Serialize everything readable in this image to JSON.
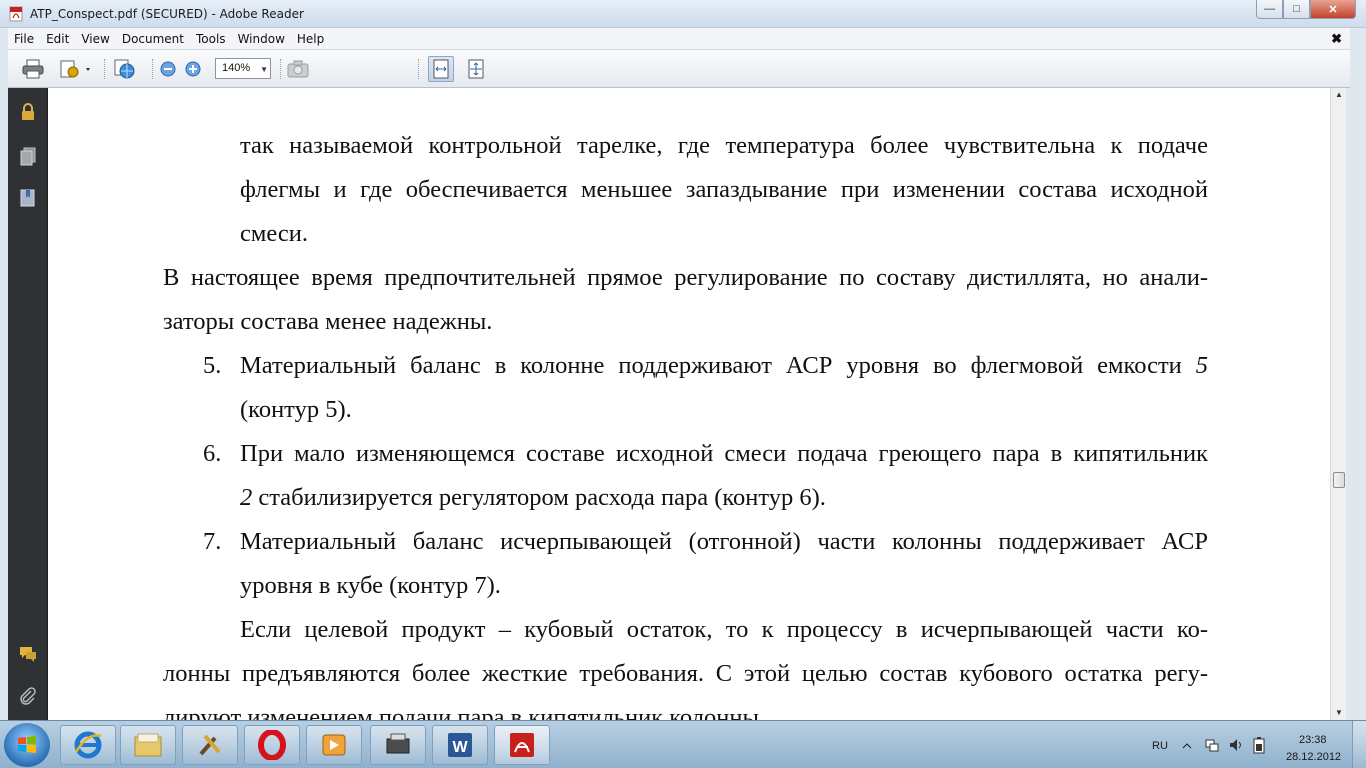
{
  "window": {
    "title": "ATP_Conspect.pdf (SECURED) - Adobe Reader",
    "min_glyph": "—",
    "max_glyph": "□",
    "close_glyph": "✕"
  },
  "menu": [
    "File",
    "Edit",
    "View",
    "Document",
    "Tools",
    "Window",
    "Help"
  ],
  "menu_close": "✖",
  "toolbar": {
    "zoom_value": "140%",
    "zoom_arrow": "▼"
  },
  "document": {
    "line1": "так называемой контрольной тарелке, где температура более чувствительна к подаче",
    "line2": "флегмы и где обеспечивается меньшее запаздывание при изменении состава исходной",
    "line3": "смеси.",
    "line4": "В настоящее время предпочтительней прямое регулирование по составу дистиллята, но анали-",
    "line5": "заторы состава менее надежны.",
    "item5_num": "5.",
    "item5_l1_text": "Материальный баланс в колонне поддерживают АСР уровня во флегмовой емкости",
    "item5_l1_ital": "5",
    "item5_l2": "(контур 5).",
    "item6_num": "6.",
    "item6_l1": "При мало изменяющемся составе исходной смеси подача греющего пара в кипятильник",
    "item6_l2_ital": "2",
    "item6_l2_text": " стабилизируется регулятором расхода пара (контур 6).",
    "item7_num": "7.",
    "item7_l1": "Материальный баланс исчерпывающей (отгонной) части колонны поддерживает АСР",
    "item7_l2": "уровня в кубе (контур 7).",
    "para_l1": "Если целевой продукт – кубовый остаток, то к процессу в исчерпывающей части ко-",
    "para_l2": "лонны предъявляются более жесткие требования. С этой целью состав кубового остатка регу-",
    "para_l3": "лируют изменением подачи пара в кипятильник колонны."
  },
  "tray": {
    "lang": "RU",
    "time": "23:38",
    "date": "28.12.2012"
  },
  "colors": {
    "leftpanel": "#2f3134",
    "pdf_red": "#c8211b"
  }
}
